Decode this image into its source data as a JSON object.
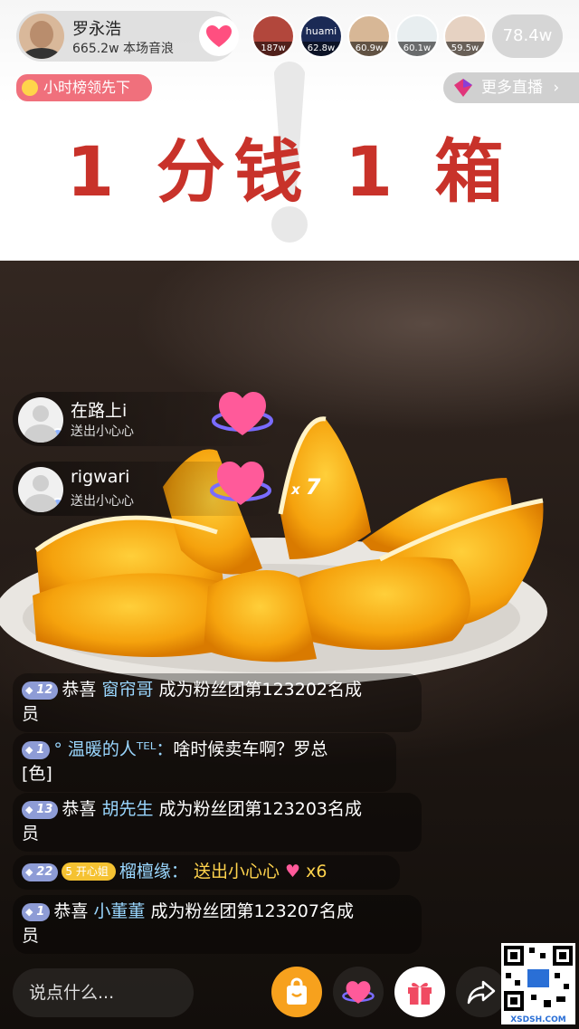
{
  "host": {
    "name": "罗永浩",
    "stat": "665.2w 本场音浪"
  },
  "top_viewers": [
    {
      "badge": "187w",
      "label": ""
    },
    {
      "badge": "62.8w",
      "label": "huami"
    },
    {
      "badge": "60.9w",
      "label": ""
    },
    {
      "badge": "60.1w",
      "label": ""
    },
    {
      "badge": "59.5w",
      "label": ""
    }
  ],
  "audience_count": "78.4w",
  "rank_label": "小时榜领先下",
  "more_live_label": "更多直播",
  "promo_text": "1 分钱 1 箱",
  "gifts": [
    {
      "name": "在路上i",
      "desc": "送出小心心"
    },
    {
      "name": "rigwari",
      "desc": "送出小心心",
      "combo_x": "x",
      "combo_n": "7"
    }
  ],
  "chat": [
    {
      "level": "12",
      "text_a": "恭喜 ",
      "user": "窗帘哥",
      "text_b": " 成为粉丝团第123202名成",
      "text_c": "员"
    },
    {
      "level": "1",
      "user": "° 温暖的人ᵀᴱᴸ：",
      "text_a": "啥时候卖车啊？罗总",
      "text_c": "[色]"
    },
    {
      "level": "13",
      "text_a": "恭喜 ",
      "user": "胡先生",
      "text_b": " 成为粉丝团第123203名成",
      "text_c": "员"
    },
    {
      "level": "22",
      "fan_level": "5",
      "fan_label": "开心姐",
      "user": "榴檀缘：",
      "text_a": "送出小心心",
      "text_b": "x6"
    },
    {
      "level": "1",
      "text_a": "恭喜 ",
      "user": "小董董",
      "text_b": " 成为粉丝团第123207名成",
      "text_c": "员"
    }
  ],
  "input_placeholder": "说点什么...",
  "watermark": "XSDSH.COM",
  "colors": {
    "promo": "#c8322a",
    "chat_user": "#9ad7ff",
    "gift_text": "#ffd34d",
    "fan_badge": "#f5c232"
  }
}
